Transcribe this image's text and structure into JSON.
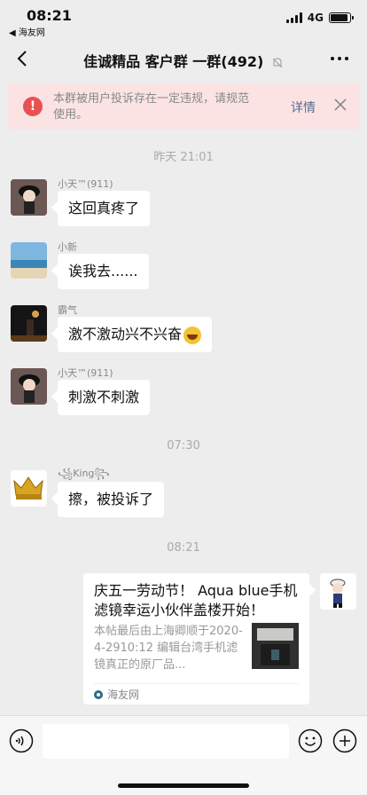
{
  "status_bar": {
    "time": "08:21",
    "back_app": "◀ 海友网",
    "network": "4G",
    "battery_level": 0.9
  },
  "nav": {
    "title": "佳诚精品 客户群 一群(492)",
    "icons": {
      "back": "chevron-left-icon",
      "mute": "bell-off-icon",
      "more": "more-icon"
    }
  },
  "warning": {
    "text": "本群被用户投诉存在一定违规，请规范使用。",
    "detail_label": "详情",
    "icon": "!"
  },
  "timestamps": [
    "昨天 21:01",
    "07:30",
    "08:21"
  ],
  "messages": [
    {
      "sender": "小天™(911)",
      "text": "这回真疼了"
    },
    {
      "sender": "小新",
      "text": "诶我去......"
    },
    {
      "sender": "霸气",
      "text": "激不激动兴不兴奋"
    },
    {
      "sender": "King",
      "text": "擦，被投诉了"
    }
  ],
  "extra_messages": {
    "sender_4": "小天™(911)",
    "text_4": "刺激不刺激"
  },
  "link_card": {
    "title": "庆五一劳动节！ Aqua blue手机滤镜幸运小伙伴盖楼开始！",
    "description": "本帖最后由上海卿顺于2020-4-2910:12 编辑台湾手机滤镜真正的原厂品...",
    "source": "海友网"
  },
  "input_bar": {
    "placeholder": "",
    "icons": [
      "voice-icon",
      "emoji-icon",
      "plus-icon"
    ]
  },
  "colors": {
    "background": "#ededed",
    "bubble": "#ffffff",
    "warning_bg": "#fbe3e3",
    "warning_icon": "#e85151",
    "link": "#576b95"
  }
}
